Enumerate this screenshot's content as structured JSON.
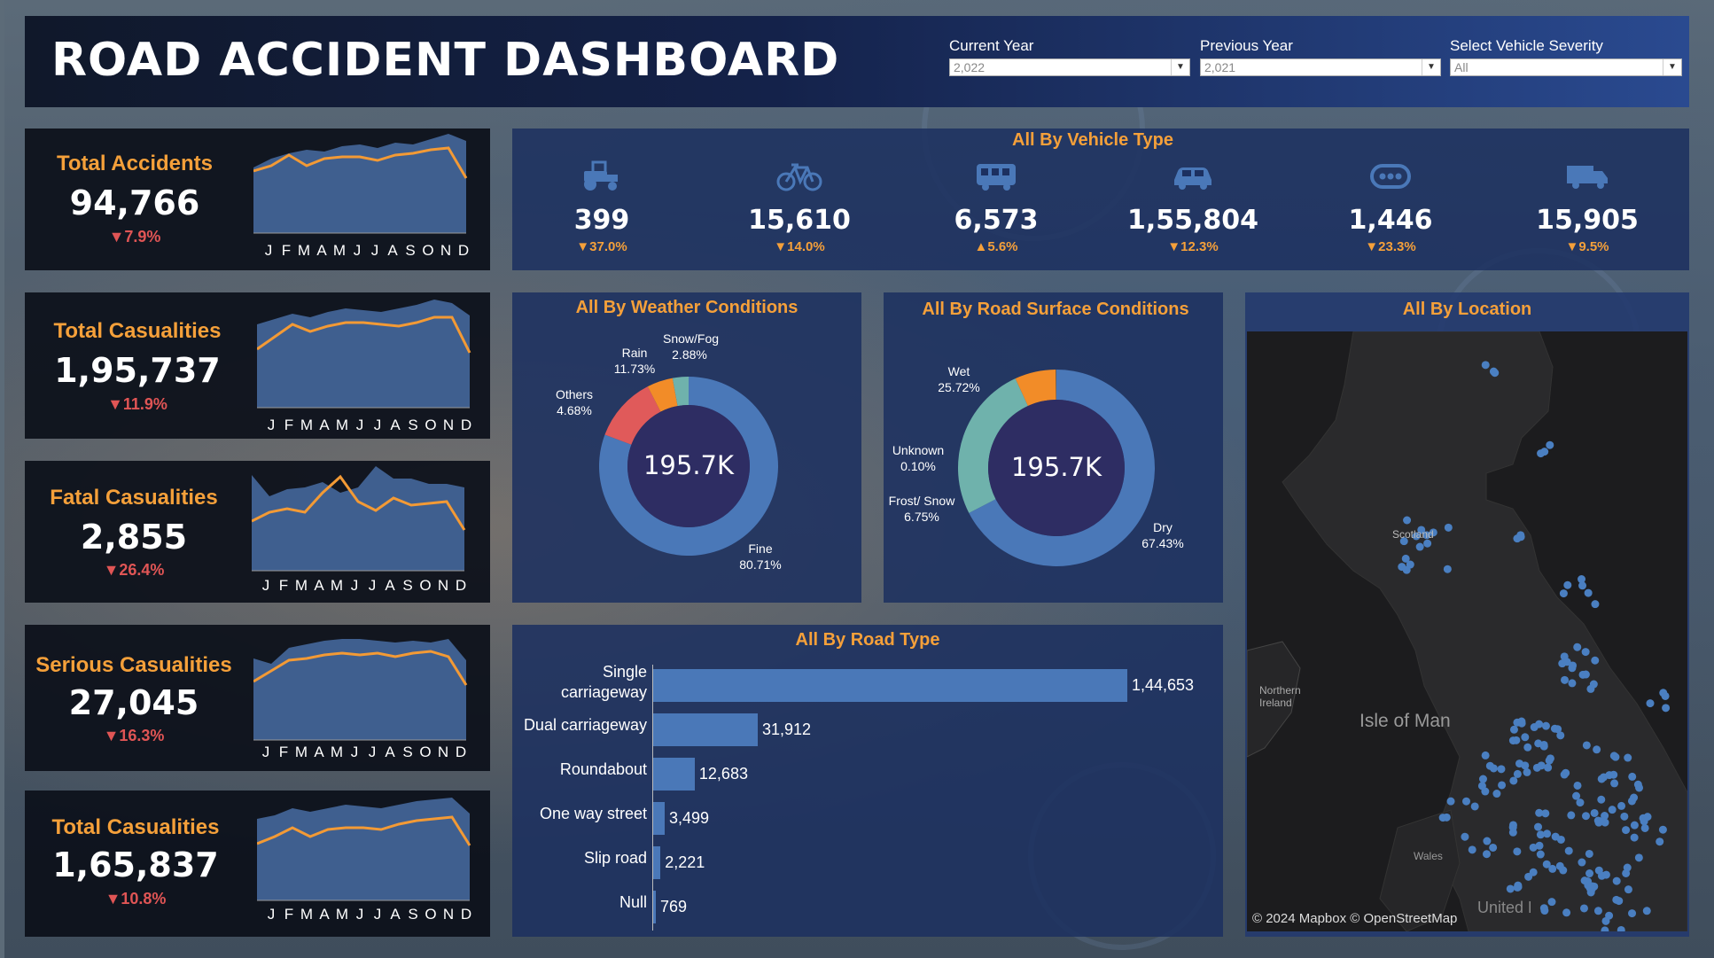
{
  "header": {
    "title": "ROAD ACCIDENT DASHBOARD",
    "filters": [
      {
        "label": "Current Year",
        "value": "2,022"
      },
      {
        "label": "Previous Year",
        "value": "2,021"
      },
      {
        "label": "Select Vehicle Severity",
        "value": "All"
      }
    ]
  },
  "kpis": [
    {
      "label": "Total Accidents",
      "value": "94,766",
      "change": "▼7.9%"
    },
    {
      "label": "Total Casualities",
      "value": "1,95,737",
      "change": "▼11.9%"
    },
    {
      "label": "Fatal Casualities",
      "value": "2,855",
      "change": "▼26.4%"
    },
    {
      "label": "Serious Casualities",
      "value": "27,045",
      "change": "▼16.3%"
    },
    {
      "label": "Total Casualities",
      "value": "1,65,837",
      "change": "▼10.8%"
    }
  ],
  "months": [
    "J",
    "F",
    "M",
    "A",
    "M",
    "J",
    "J",
    "A",
    "S",
    "O",
    "N",
    "D"
  ],
  "vehicle_section": {
    "title": "All By Vehicle Type",
    "items": [
      {
        "icon": "tractor-icon",
        "value": "399",
        "change": "▼37.0%"
      },
      {
        "icon": "bicycle-icon",
        "value": "15,610",
        "change": "▼14.0%"
      },
      {
        "icon": "bus-icon",
        "value": "6,573",
        "change": "▲5.6%"
      },
      {
        "icon": "car-icon",
        "value": "1,55,804",
        "change": "▼12.3%"
      },
      {
        "icon": "others-icon",
        "value": "1,446",
        "change": "▼23.3%"
      },
      {
        "icon": "van-icon",
        "value": "15,905",
        "change": "▼9.5%"
      }
    ]
  },
  "weather": {
    "title": "All By Weather Conditions",
    "center": "195.7K",
    "labels": [
      {
        "name": "Snow/Fog",
        "pct": "2.88%"
      },
      {
        "name": "Rain",
        "pct": "11.73%"
      },
      {
        "name": "Others",
        "pct": "4.68%"
      },
      {
        "name": "Fine",
        "pct": "80.71%"
      }
    ]
  },
  "surface": {
    "title": "All By Road Surface Conditions",
    "center": "195.7K",
    "labels": [
      {
        "name": "Wet",
        "pct": "25.72%"
      },
      {
        "name": "Unknown",
        "pct": "0.10%"
      },
      {
        "name": "Frost/ Snow",
        "pct": "6.75%"
      },
      {
        "name": "Dry",
        "pct": "67.43%"
      }
    ]
  },
  "location": {
    "title": "All By Location",
    "places": [
      "Scotland",
      "Northern Ireland",
      "Isle of Man",
      "Wales",
      "United Kingdom"
    ],
    "attribution": "© 2024 Mapbox © OpenStreetMap"
  },
  "road_type": {
    "title": "All By Road Type",
    "rows": [
      {
        "label": "Single carriageway",
        "value": "1,44,653"
      },
      {
        "label": "Dual carriageway",
        "value": "31,912"
      },
      {
        "label": "Roundabout",
        "value": "12,683"
      },
      {
        "label": "One way street",
        "value": "3,499"
      },
      {
        "label": "Slip road",
        "value": "2,221"
      },
      {
        "label": "Null",
        "value": "769"
      }
    ]
  },
  "colors": {
    "accent": "#f5a03a",
    "down": "#e05555",
    "area": "#3f5f8f",
    "line": "#f39a35",
    "bar": "#4a78b8",
    "teal": "#6fb2ac",
    "red": "#e05a5a",
    "orange": "#f28c28"
  },
  "chart_data": [
    {
      "type": "donut",
      "title": "All By Weather Conditions",
      "categories": [
        "Fine",
        "Rain",
        "Others",
        "Snow/Fog"
      ],
      "values": [
        80.71,
        11.73,
        4.68,
        2.88
      ],
      "center_label": "195.7K"
    },
    {
      "type": "donut",
      "title": "All By Road Surface Conditions",
      "categories": [
        "Dry",
        "Wet",
        "Frost/ Snow",
        "Unknown"
      ],
      "values": [
        67.43,
        25.72,
        6.75,
        0.1
      ],
      "center_label": "195.7K"
    },
    {
      "type": "bar",
      "orientation": "horizontal",
      "title": "All By Road Type",
      "categories": [
        "Single carriageway",
        "Dual carriageway",
        "Roundabout",
        "One way street",
        "Slip road",
        "Null"
      ],
      "values": [
        144653,
        31912,
        12683,
        3499,
        2221,
        769
      ]
    }
  ]
}
